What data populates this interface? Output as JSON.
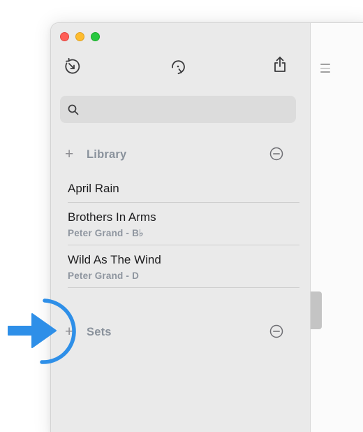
{
  "window": {
    "traffic_lights": [
      "close",
      "minimize",
      "zoom"
    ]
  },
  "toolbar": {
    "icons": [
      "rewind-icon",
      "reload-icon",
      "share-icon"
    ]
  },
  "search": {
    "placeholder": "",
    "value": ""
  },
  "library": {
    "label": "Library",
    "add_symbol": "+",
    "songs": [
      {
        "title": "April Rain",
        "subtitle": ""
      },
      {
        "title": "Brothers In Arms",
        "subtitle": "Peter Grand - B♭"
      },
      {
        "title": "Wild As The Wind",
        "subtitle": "Peter Grand - D"
      }
    ]
  },
  "sets": {
    "label": "Sets",
    "add_symbol": "+"
  },
  "colors": {
    "sidebar_bg": "#eaeaea",
    "accent_annotation": "#2e8fe8",
    "section_label": "#8a929c"
  }
}
